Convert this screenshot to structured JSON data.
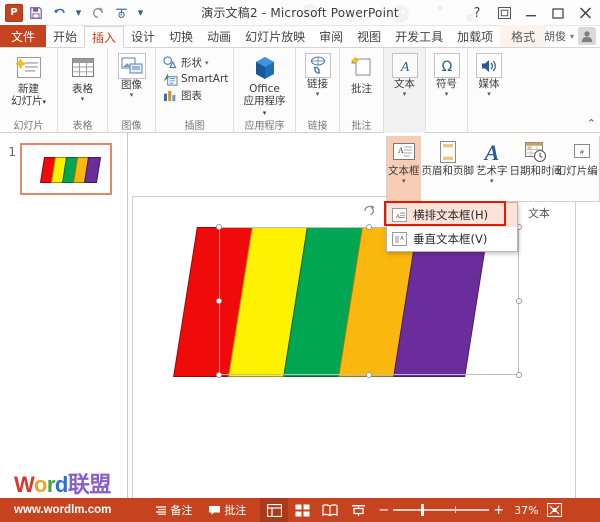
{
  "titlebar": {
    "app_icon": "powerpoint-icon",
    "title": "演示文稿2 - Microsoft PowerPoint",
    "quick_access": [
      {
        "name": "save",
        "icon": "save-icon"
      },
      {
        "name": "undo",
        "icon": "undo-icon"
      },
      {
        "name": "redo",
        "icon": "redo-icon"
      },
      {
        "name": "start-slideshow",
        "icon": "slideshow-icon"
      },
      {
        "name": "customize-qat",
        "icon": "chevron-down-icon"
      }
    ],
    "window_buttons": [
      {
        "name": "help",
        "glyph": "?"
      },
      {
        "name": "ribbon-display-options",
        "glyph": "▣"
      },
      {
        "name": "minimize",
        "glyph": "−"
      },
      {
        "name": "maximize",
        "glyph": "▢"
      },
      {
        "name": "close",
        "glyph": "✕"
      }
    ]
  },
  "tabs": [
    {
      "label": "文件",
      "state": "file"
    },
    {
      "label": "开始",
      "state": "normal"
    },
    {
      "label": "插入",
      "state": "active"
    },
    {
      "label": "设计",
      "state": "normal"
    },
    {
      "label": "切换",
      "state": "normal"
    },
    {
      "label": "动画",
      "state": "normal"
    },
    {
      "label": "幻灯片放映",
      "state": "normal"
    },
    {
      "label": "审阅",
      "state": "normal"
    },
    {
      "label": "视图",
      "state": "normal"
    },
    {
      "label": "开发工具",
      "state": "normal"
    },
    {
      "label": "加载项",
      "state": "normal"
    },
    {
      "label": "格式",
      "state": "contextual"
    }
  ],
  "user": {
    "name": "胡俊",
    "caret": "▾"
  },
  "ribbon": {
    "groups": [
      {
        "label": "幻灯片",
        "buttons": [
          {
            "name": "new-slide",
            "label_line1": "新建",
            "label_line2": "幻灯片",
            "caret": "▾",
            "icon": "new-slide-icon"
          }
        ]
      },
      {
        "label": "表格",
        "buttons": [
          {
            "name": "table",
            "label_line1": "表格",
            "label_line2": "",
            "caret": "▾",
            "icon": "table-icon"
          }
        ]
      },
      {
        "label": "图像",
        "buttons": [
          {
            "name": "images",
            "label_line1": "图像",
            "label_line2": "",
            "caret": "▾",
            "icon": "image-icon"
          }
        ]
      },
      {
        "label": "插图",
        "small_buttons": [
          {
            "name": "shapes",
            "label": "形状",
            "caret": "▾",
            "icon": "shapes-icon"
          },
          {
            "name": "smartart",
            "label": "SmartArt",
            "caret": "",
            "icon": "smartart-icon"
          },
          {
            "name": "chart",
            "label": "图表",
            "caret": "",
            "icon": "chart-icon"
          }
        ]
      },
      {
        "label": "应用程序",
        "buttons": [
          {
            "name": "office-apps",
            "label_line1": "Office",
            "label_line2": "应用程序",
            "caret": "▾",
            "icon": "office-apps-icon"
          }
        ]
      },
      {
        "label": "链接",
        "buttons": [
          {
            "name": "links",
            "label_line1": "链接",
            "label_line2": "",
            "caret": "▾",
            "icon": "link-icon"
          }
        ]
      },
      {
        "label": "批注",
        "buttons": [
          {
            "name": "comment",
            "label_line1": "批注",
            "label_line2": "",
            "caret": "",
            "icon": "comment-icon"
          }
        ]
      },
      {
        "label": "",
        "buttons": [
          {
            "name": "text",
            "label_line1": "文本",
            "label_line2": "",
            "caret": "▾",
            "icon": "text-icon"
          }
        ]
      },
      {
        "label": "",
        "buttons": [
          {
            "name": "symbol",
            "label_line1": "符号",
            "label_line2": "",
            "caret": "▾",
            "icon": "omega-icon"
          }
        ]
      },
      {
        "label": "",
        "buttons": [
          {
            "name": "media",
            "label_line1": "媒体",
            "label_line2": "",
            "caret": "▾",
            "icon": "speaker-icon"
          }
        ]
      }
    ],
    "collapse_glyph": "⌃"
  },
  "text_panel": {
    "items": [
      {
        "name": "text-box",
        "label": "文本框",
        "caret": "▾",
        "icon": "text-box-icon",
        "active": true
      },
      {
        "name": "header-footer",
        "label": "页眉和页脚",
        "caret": "",
        "icon": "header-footer-icon",
        "active": false
      },
      {
        "name": "wordart",
        "label": "艺术字",
        "caret": "▾",
        "icon": "wordart-icon",
        "active": false
      },
      {
        "name": "date-time",
        "label": "日期和时间",
        "caret": "",
        "icon": "date-time-icon",
        "active": false
      },
      {
        "name": "slide-number",
        "label": "幻灯片编号",
        "caret": "",
        "icon": "slide-number-icon",
        "active": false
      }
    ],
    "group_label": "文本"
  },
  "dropdown": {
    "items": [
      {
        "name": "horizontal-text-box",
        "label": "横排文本框(H)",
        "icon": "horizontal-textbox-icon",
        "highlighted": true
      },
      {
        "name": "vertical-text-box",
        "label": "垂直文本框(V)",
        "icon": "vertical-textbox-icon",
        "highlighted": false
      }
    ],
    "highlight_border_color": "#e01b00"
  },
  "thumbnail_pane": {
    "slides": [
      {
        "number": "1",
        "selected": true
      }
    ]
  },
  "slide": {
    "shape": {
      "name": "rainbow-parallelogram-group",
      "stripes": [
        {
          "name": "stripe-red",
          "color": "#F10A0A"
        },
        {
          "name": "stripe-yellow",
          "color": "#FFF200"
        },
        {
          "name": "stripe-green",
          "color": "#00A652"
        },
        {
          "name": "stripe-orange",
          "color": "#FAB70E"
        },
        {
          "name": "stripe-purple",
          "color": "#6C2D9C"
        }
      ]
    },
    "selected": true,
    "rotate_handle": "rotate-handle"
  },
  "watermark": {
    "letters": [
      {
        "ch": "W",
        "color": "#d8372b"
      },
      {
        "ch": "o",
        "color": "#e8a81e"
      },
      {
        "ch": "r",
        "color": "#3fa33f"
      },
      {
        "ch": "d",
        "color": "#2b6fd8"
      },
      {
        "ch": "联",
        "color": "#8a5ec9"
      },
      {
        "ch": "盟",
        "color": "#8a5ec9"
      }
    ],
    "url": "www.wordlm.com"
  },
  "statusbar": {
    "notes_label": "备注",
    "comments_label": "批注",
    "views": [
      {
        "name": "normal-view",
        "icon": "normal-view-icon",
        "active": true
      },
      {
        "name": "slide-sorter-view",
        "icon": "slide-sorter-icon",
        "active": false
      },
      {
        "name": "reading-view",
        "icon": "reading-view-icon",
        "active": false
      },
      {
        "name": "slideshow-view",
        "icon": "slideshow-icon",
        "active": false
      }
    ],
    "zoom_out": "−",
    "zoom_in": "+",
    "zoom_level": "37%",
    "fit_label": "fit-to-window-icon"
  }
}
